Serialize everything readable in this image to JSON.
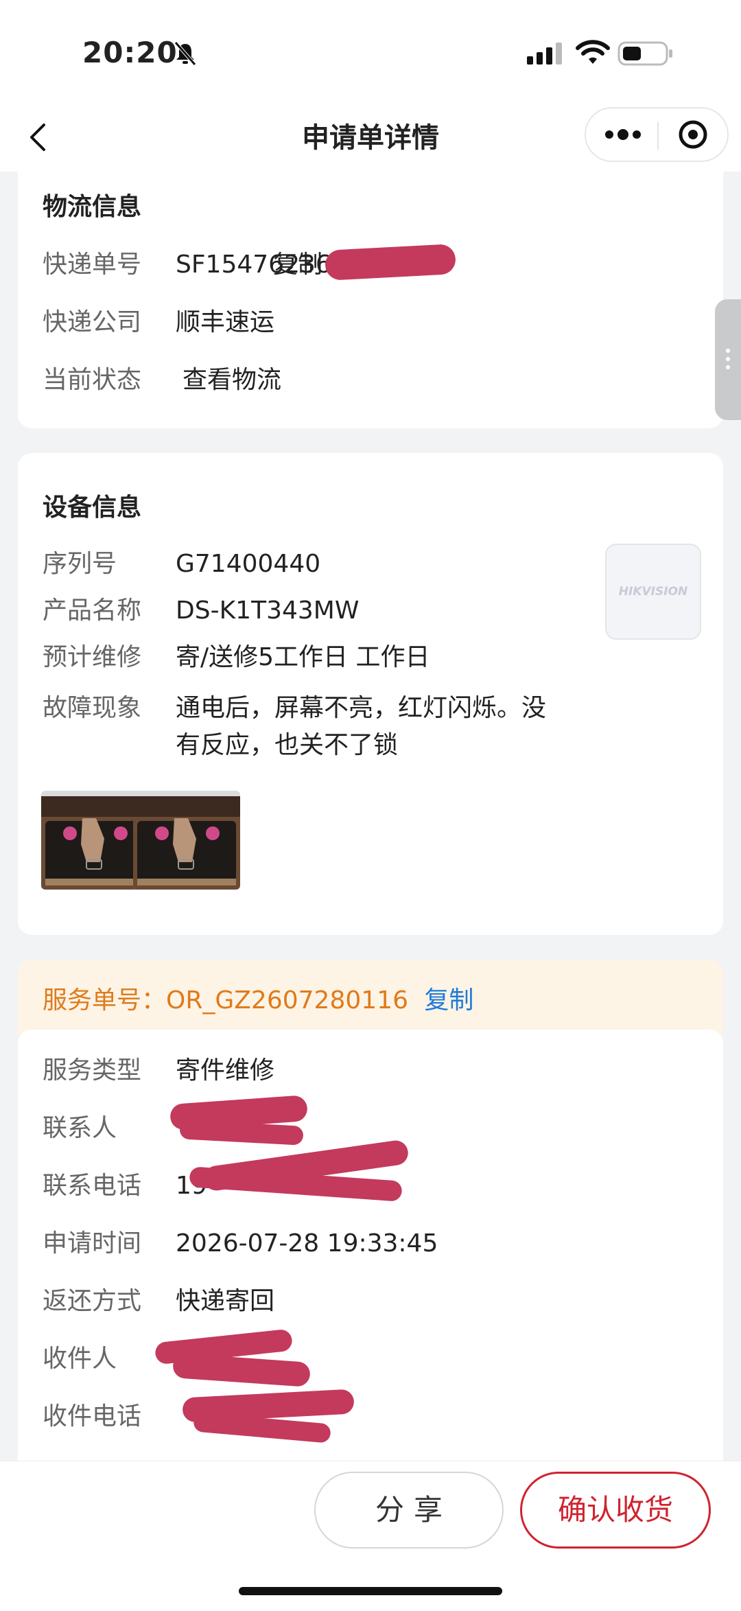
{
  "status_bar": {
    "time": "20:20"
  },
  "nav": {
    "title": "申请单详情"
  },
  "logistics": {
    "title": "物流信息",
    "tracking_label": "快递单号",
    "tracking_value": "SF15476236",
    "tracking_copy": "复制",
    "company_label": "快递公司",
    "company_value": "顺丰速运",
    "status_label": "当前状态",
    "status_link": "查看物流"
  },
  "device": {
    "title": "设备信息",
    "serial_label": "序列号",
    "serial_value": "G71400440",
    "product_label": "产品名称",
    "product_value": "DS-K1T343MW",
    "repair_label": "预计维修",
    "repair_value": "寄/送修5工作日 工作日",
    "fault_label": "故障现象",
    "fault_line1": "通电后，屏幕不亮，红灯闪烁。没",
    "fault_line2": "有反应，也关不了锁",
    "thumb_brand": "HIKVISION"
  },
  "service": {
    "order_label": "服务单号：",
    "order_value": "OR_GZ2607280116",
    "order_copy": "复制",
    "type_label": "服务类型",
    "type_value": "寄件维修",
    "contact_label": "联系人",
    "phone_label": "联系电话",
    "phone_partial": "19",
    "time_label": "申请时间",
    "time_value": "2026-07-28 19:33:45",
    "return_label": "返还方式",
    "return_value": "快递寄回",
    "receiver_label": "收件人",
    "receiver_phone_label": "收件电话"
  },
  "bottom": {
    "share_label": "分享",
    "confirm_label": "确认收货"
  },
  "colors": {
    "link": "#1f7ad9",
    "service_orange": "#e07a1a",
    "confirm_red": "#d0232f",
    "redaction": "#c33a5c"
  }
}
